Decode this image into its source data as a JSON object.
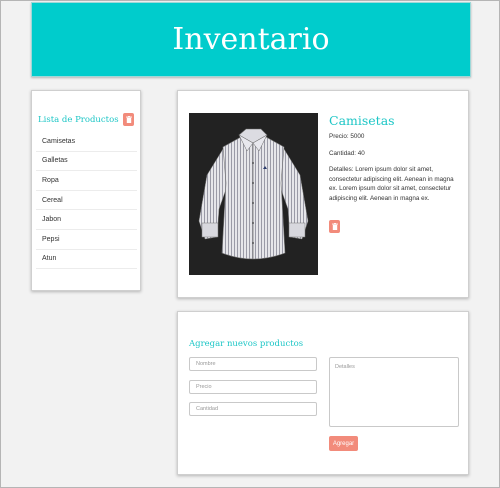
{
  "header": {
    "title": "Inventario"
  },
  "list": {
    "title": "Lista de Productos",
    "items": [
      "Camisetas",
      "Galletas",
      "Ropa",
      "Cereal",
      "Jabon",
      "Pepsi",
      "Atun"
    ]
  },
  "detail": {
    "name": "Camisetas",
    "price": "Precio: 5000",
    "quantity": "Cantidad: 40",
    "description": "Detalles: Lorem ipsum dolor sit amet, consectetur adipiscing elit. Aenean in magna ex. Lorem ipsum dolor sit amet, consectetur adipiscing elit. Aenean in magna ex."
  },
  "form": {
    "title": "Agregar nuevos productos",
    "name_placeholder": "Nombre",
    "price_placeholder": "Precio",
    "quantity_placeholder": "Cantidad",
    "details_placeholder": "Detalles",
    "submit_label": "Agregar"
  },
  "icons": {
    "delete": "trash-icon"
  },
  "colors": {
    "accent": "#00cccc",
    "title_text": "#1cc6c6",
    "danger": "#f28b7b"
  }
}
